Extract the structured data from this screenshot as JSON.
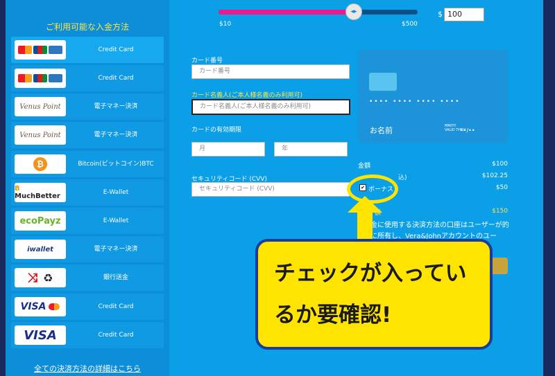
{
  "sidebar": {
    "title": "ご利用可能な入金方法",
    "methods": [
      {
        "label": "Credit Card",
        "logo": "cc-logos"
      },
      {
        "label": "Credit Card",
        "logo": "cc-logos"
      },
      {
        "label": "電子マネー決済",
        "logo": "Venus Point"
      },
      {
        "label": "電子マネー決済",
        "logo": "Venus Point"
      },
      {
        "label": "Bitcoin(ビットコイン)BTC",
        "logo": "bitcoin-icon"
      },
      {
        "label": "E-Wallet",
        "logo": "MuchBetter"
      },
      {
        "label": "E-Wallet",
        "logo": "ecoPayz"
      },
      {
        "label": "電子マネー決済",
        "logo": "iwallet"
      },
      {
        "label": "銀行送金",
        "logo": "bank-icon"
      },
      {
        "label": "Credit Card",
        "logo": "VISA"
      },
      {
        "label": "Credit Card",
        "logo": "VISA"
      }
    ],
    "link": "全ての決済方法の詳細はこちら"
  },
  "slider": {
    "min_label": "$10",
    "max_label": "$500",
    "value": 100,
    "min": 10,
    "max": 500
  },
  "amount": {
    "currency": "$",
    "value": "100"
  },
  "form": {
    "card_number_label": "カード番号",
    "card_number_placeholder": "カード番号",
    "holder_label": "カード名義人(ご本人様名義のみ利用可)",
    "holder_placeholder": "カード名義人(ご本人様名義のみ利用可)",
    "expiry_label": "カードの有効期限",
    "month_placeholder": "月",
    "year_placeholder": "年",
    "cvv_label": "セキュリティコード (CVV)",
    "cvv_placeholder": "セキュリティコード (CVV)"
  },
  "card": {
    "number_mask": "•••• •••• •••• ••••",
    "name": "お名前",
    "valid_thru": "VALID\nTHRU",
    "mm_yy": "MM/YY",
    "expiry_mask": "••/••"
  },
  "summary": {
    "amount_label": "金額",
    "amount_value": "$100",
    "fee_label_partial": "込)",
    "fee_value": "$102.25",
    "bonus_checkbox_label": "ボーナス",
    "bonus_checked": true,
    "bonus_value": "$50",
    "total_label_partial": "額",
    "total_value": "$150",
    "notice": "金に使用する決済方法の口座はユーザーが的に所有し、Vera&Johnアカウントのユー"
  },
  "callout": {
    "line1": "チェックが入ってい",
    "line2": "るか要確認!"
  },
  "colors": {
    "panel": "#0a9fe6",
    "accent_pink": "#ec1a8c",
    "yellow": "#ffe400",
    "label_yellow": "#ffe34a"
  }
}
